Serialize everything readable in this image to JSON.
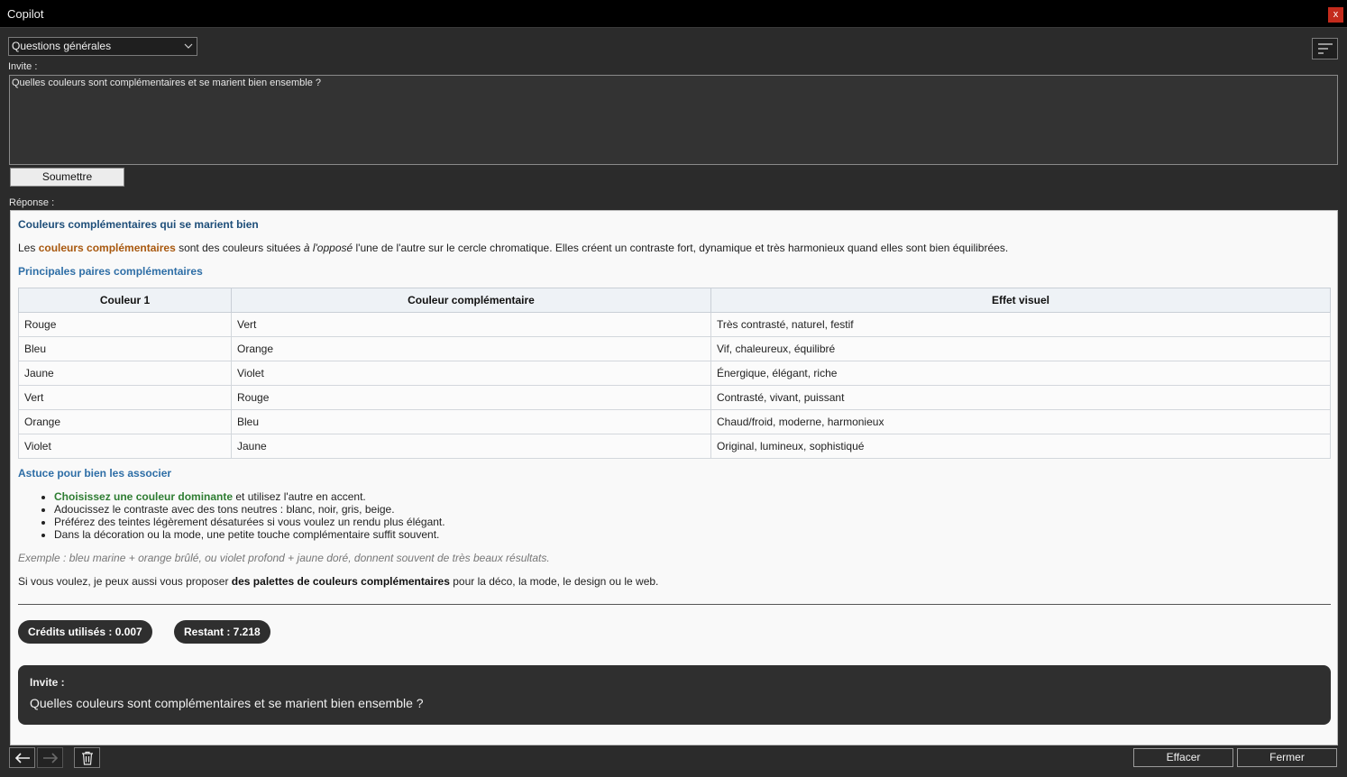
{
  "window": {
    "title": "Copilot",
    "close_glyph": "x"
  },
  "mode_select": {
    "value": "Questions générales"
  },
  "prompt": {
    "label": "Invite :",
    "value": "Quelles couleurs sont complémentaires et se marient bien ensemble ?",
    "submit_label": "Soumettre"
  },
  "response": {
    "label": "Réponse :",
    "heading": "Couleurs complémentaires qui se marient bien",
    "intro": {
      "p1": "Les ",
      "highlight": "couleurs complémentaires",
      "p2": " sont des couleurs situées ",
      "italic": "à l'opposé",
      "p3": " l'une de l'autre sur le cercle chromatique. Elles créent un contraste fort, dynamique et très harmonieux quand elles sont bien équilibrées."
    },
    "pairs_heading": "Principales paires complémentaires",
    "table": {
      "headers": [
        "Couleur 1",
        "Couleur complémentaire",
        "Effet visuel"
      ],
      "rows": [
        [
          "Rouge",
          "Vert",
          "Très contrasté, naturel, festif"
        ],
        [
          "Bleu",
          "Orange",
          "Vif, chaleureux, équilibré"
        ],
        [
          "Jaune",
          "Violet",
          "Énergique, élégant, riche"
        ],
        [
          "Vert",
          "Rouge",
          "Contrasté, vivant, puissant"
        ],
        [
          "Orange",
          "Bleu",
          "Chaud/froid, moderne, harmonieux"
        ],
        [
          "Violet",
          "Jaune",
          "Original, lumineux, sophistiqué"
        ]
      ]
    },
    "tips_heading": "Astuce pour bien les associer",
    "tips": {
      "first_highlight": "Choisissez une couleur dominante",
      "first_rest": " et utilisez l'autre en accent.",
      "second": "Adoucissez le contraste avec des tons neutres : blanc, noir, gris, beige.",
      "third": "Préférez des teintes légèrement désaturées si vous voulez un rendu plus élégant.",
      "fourth": "Dans la décoration ou la mode, une petite touche complémentaire suffit souvent."
    },
    "example": "Exemple : bleu marine + orange brûlé, ou violet profond + jaune doré, donnent souvent de très beaux résultats.",
    "outro": {
      "p1": "Si vous voulez, je peux aussi vous proposer ",
      "bold": "des palettes de couleurs complémentaires",
      "p2": " pour la déco, la mode, le design ou le web."
    },
    "credits_used": "Crédits utilisés : 0.007",
    "credits_left": "Restant : 7.218",
    "echo": {
      "label": "Invite :",
      "text": "Quelles couleurs sont complémentaires et se marient bien ensemble ?"
    }
  },
  "footer": {
    "clear_label": "Effacer",
    "close_label": "Fermer"
  },
  "icons": {
    "back": "arrow-left-icon",
    "forward": "arrow-right-icon",
    "delete": "trash-icon",
    "menu": "sort-lines-icon"
  }
}
